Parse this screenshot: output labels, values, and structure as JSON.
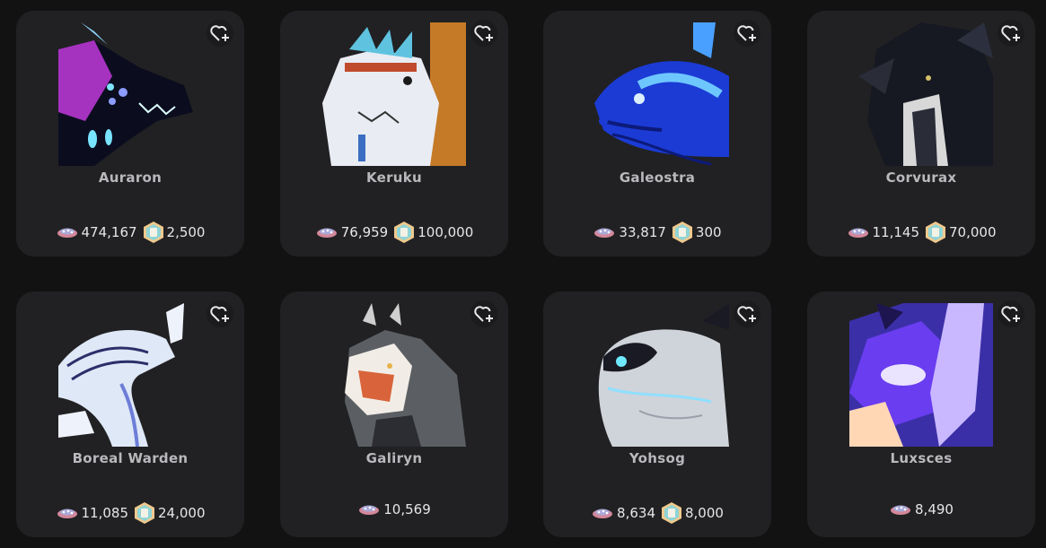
{
  "cards": [
    {
      "name": "Auraron",
      "value": "474,167",
      "cost": "2,500",
      "accent": "#b53cc9",
      "accent2": "#0d1030"
    },
    {
      "name": "Keruku",
      "value": "76,959",
      "cost": "100,000",
      "accent": "#e9ecf3",
      "accent2": "#c47a27"
    },
    {
      "name": "Galeostra",
      "value": "33,817",
      "cost": "300",
      "accent": "#1b3bd4",
      "accent2": "#6ec6ff"
    },
    {
      "name": "Corvurax",
      "value": "11,145",
      "cost": "70,000",
      "accent": "#1a1c26",
      "accent2": "#d8d8d8"
    },
    {
      "name": "Boreal Warden",
      "value": "11,085",
      "cost": "24,000",
      "accent": "#dfe8f6",
      "accent2": "#2a2f6a"
    },
    {
      "name": "Galiryn",
      "value": "10,569",
      "cost": "",
      "accent": "#3a3a3f",
      "accent2": "#d9643b"
    },
    {
      "name": "Yohsog",
      "value": "8,634",
      "cost": "8,000",
      "accent": "#cfd3da",
      "accent2": "#1a1a24"
    },
    {
      "name": "Luxsces",
      "value": "8,490",
      "cost": "",
      "accent": "#6a3df0",
      "accent2": "#ffd7b5"
    }
  ]
}
